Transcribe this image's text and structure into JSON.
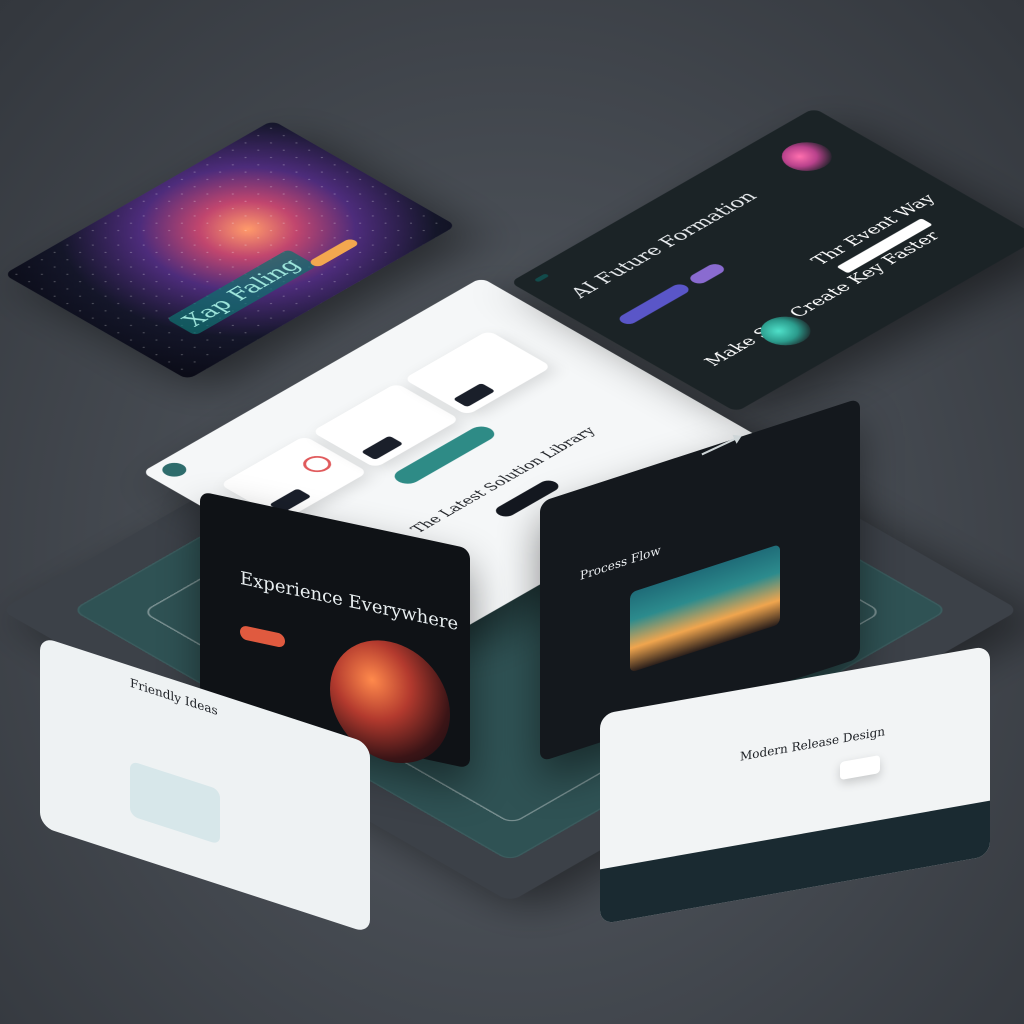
{
  "scene": {
    "platform_label": "",
    "galaxy": {
      "title": "Xap Faling",
      "side_text": "",
      "cta": ""
    },
    "center": {
      "nav": {
        "item1": "",
        "item2": "",
        "item3": ""
      },
      "headline": "The Latest Solution Library",
      "cta_primary": "",
      "cta_secondary": ""
    },
    "coral": {
      "tag": "",
      "headline": "AI Future Formation",
      "section_heading": "Thr Event Way",
      "bottom_heading": "Make Site Create Key Faster"
    },
    "laptop_left": {
      "title": "Experience Everywhere",
      "subtitle": "Friendly Ideas"
    },
    "laptop_right": {
      "title": "Process Flow",
      "heading": "Modern Release Design"
    }
  },
  "colors": {
    "accent_teal": "#2e8b86",
    "dark_teal": "#124b4b",
    "orange": "#f3a74f",
    "red_orange": "#e05a3f",
    "purple": "#5a56c8"
  },
  "icons": {
    "logo": "logo-icon",
    "ring": "ring-icon",
    "arrow": "arrow-icon"
  }
}
